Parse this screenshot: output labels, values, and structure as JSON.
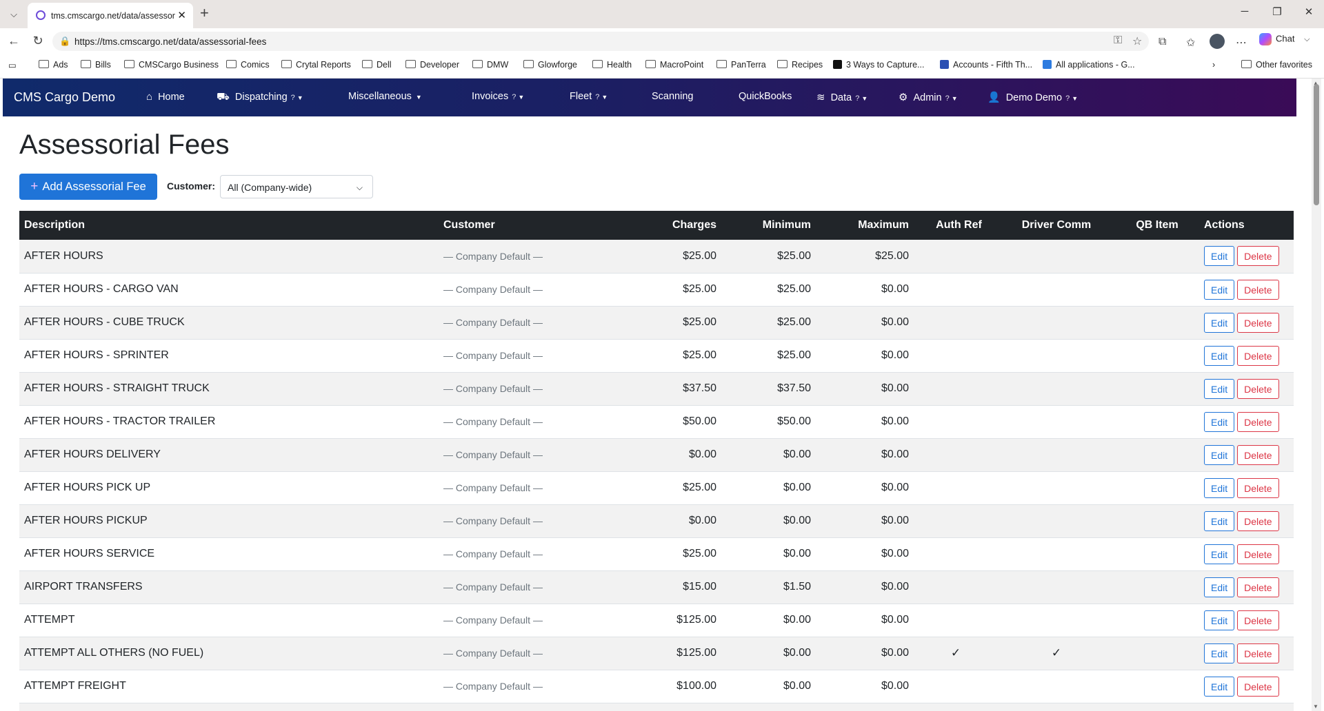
{
  "browser": {
    "tab_title": "tms.cmscargo.net/data/assessorial-fees",
    "url": "https://tms.cmscargo.net/data/assessorial-fees",
    "chat_label": "Chat",
    "bookmarks": [
      "Ads",
      "Bills",
      "CMSCargo Business",
      "Comics",
      "Crytal Reports",
      "Dell",
      "Developer",
      "DMW",
      "Glowforge",
      "Health",
      "MacroPoint",
      "PanTerra",
      "Recipes",
      "3 Ways to Capture...",
      "Accounts - Fifth Th...",
      "All applications - G..."
    ],
    "other_favorites": "Other favorites"
  },
  "nav": {
    "brand": "CMS Cargo Demo",
    "items": [
      {
        "label": "Home",
        "icon": "home-icon"
      },
      {
        "label": "Dispatching",
        "icon": "truck-icon",
        "help": "?"
      },
      {
        "label": "Miscellaneous",
        "help": ""
      },
      {
        "label": "Invoices",
        "help": "?"
      },
      {
        "label": "Fleet",
        "help": "?"
      },
      {
        "label": "Scanning"
      },
      {
        "label": "QuickBooks"
      },
      {
        "label": "Data",
        "icon": "database-icon",
        "help": "?"
      },
      {
        "label": "Admin",
        "icon": "gear-icon",
        "help": "?"
      },
      {
        "label": "Demo Demo",
        "icon": "user-icon",
        "help": "?"
      }
    ]
  },
  "page": {
    "title": "Assessorial Fees",
    "add_button": "Add Assessorial Fee",
    "customer_label": "Customer:",
    "customer_value": "All (Company-wide)"
  },
  "table": {
    "headers": [
      "Description",
      "Customer",
      "Charges",
      "Minimum",
      "Maximum",
      "Auth Ref",
      "Driver Comm",
      "QB Item",
      "Actions"
    ],
    "edit_label": "Edit",
    "delete_label": "Delete",
    "rows": [
      {
        "description": "AFTER HOURS",
        "customer": "— Company Default —",
        "charges": "$25.00",
        "minimum": "$25.00",
        "maximum": "$25.00",
        "auth_ref": "",
        "driver_comm": "",
        "qb_item": ""
      },
      {
        "description": "AFTER HOURS - CARGO VAN",
        "customer": "— Company Default —",
        "charges": "$25.00",
        "minimum": "$25.00",
        "maximum": "$0.00",
        "auth_ref": "",
        "driver_comm": "",
        "qb_item": ""
      },
      {
        "description": "AFTER HOURS - CUBE TRUCK",
        "customer": "— Company Default —",
        "charges": "$25.00",
        "minimum": "$25.00",
        "maximum": "$0.00",
        "auth_ref": "",
        "driver_comm": "",
        "qb_item": ""
      },
      {
        "description": "AFTER HOURS - SPRINTER",
        "customer": "— Company Default —",
        "charges": "$25.00",
        "minimum": "$25.00",
        "maximum": "$0.00",
        "auth_ref": "",
        "driver_comm": "",
        "qb_item": ""
      },
      {
        "description": "AFTER HOURS - STRAIGHT TRUCK",
        "customer": "— Company Default —",
        "charges": "$37.50",
        "minimum": "$37.50",
        "maximum": "$0.00",
        "auth_ref": "",
        "driver_comm": "",
        "qb_item": ""
      },
      {
        "description": "AFTER HOURS - TRACTOR TRAILER",
        "customer": "— Company Default —",
        "charges": "$50.00",
        "minimum": "$50.00",
        "maximum": "$0.00",
        "auth_ref": "",
        "driver_comm": "",
        "qb_item": ""
      },
      {
        "description": "AFTER HOURS DELIVERY",
        "customer": "— Company Default —",
        "charges": "$0.00",
        "minimum": "$0.00",
        "maximum": "$0.00",
        "auth_ref": "",
        "driver_comm": "",
        "qb_item": ""
      },
      {
        "description": "AFTER HOURS PICK UP",
        "customer": "— Company Default —",
        "charges": "$25.00",
        "minimum": "$0.00",
        "maximum": "$0.00",
        "auth_ref": "",
        "driver_comm": "",
        "qb_item": ""
      },
      {
        "description": "AFTER HOURS PICKUP",
        "customer": "— Company Default —",
        "charges": "$0.00",
        "minimum": "$0.00",
        "maximum": "$0.00",
        "auth_ref": "",
        "driver_comm": "",
        "qb_item": ""
      },
      {
        "description": "AFTER HOURS SERVICE",
        "customer": "— Company Default —",
        "charges": "$25.00",
        "minimum": "$0.00",
        "maximum": "$0.00",
        "auth_ref": "",
        "driver_comm": "",
        "qb_item": ""
      },
      {
        "description": "AIRPORT TRANSFERS",
        "customer": "— Company Default —",
        "charges": "$15.00",
        "minimum": "$1.50",
        "maximum": "$0.00",
        "auth_ref": "",
        "driver_comm": "",
        "qb_item": ""
      },
      {
        "description": "ATTEMPT",
        "customer": "— Company Default —",
        "charges": "$125.00",
        "minimum": "$0.00",
        "maximum": "$0.00",
        "auth_ref": "",
        "driver_comm": "",
        "qb_item": ""
      },
      {
        "description": "ATTEMPT ALL OTHERS (NO FUEL)",
        "customer": "— Company Default —",
        "charges": "$125.00",
        "minimum": "$0.00",
        "maximum": "$0.00",
        "auth_ref": "✓",
        "driver_comm": "✓",
        "qb_item": ""
      },
      {
        "description": "ATTEMPT FREIGHT",
        "customer": "— Company Default —",
        "charges": "$100.00",
        "minimum": "$0.00",
        "maximum": "$0.00",
        "auth_ref": "",
        "driver_comm": "",
        "qb_item": ""
      },
      {
        "description": "",
        "customer": "",
        "charges": "",
        "minimum": "",
        "maximum": "",
        "auth_ref": "",
        "driver_comm": "",
        "qb_item": ""
      }
    ]
  }
}
